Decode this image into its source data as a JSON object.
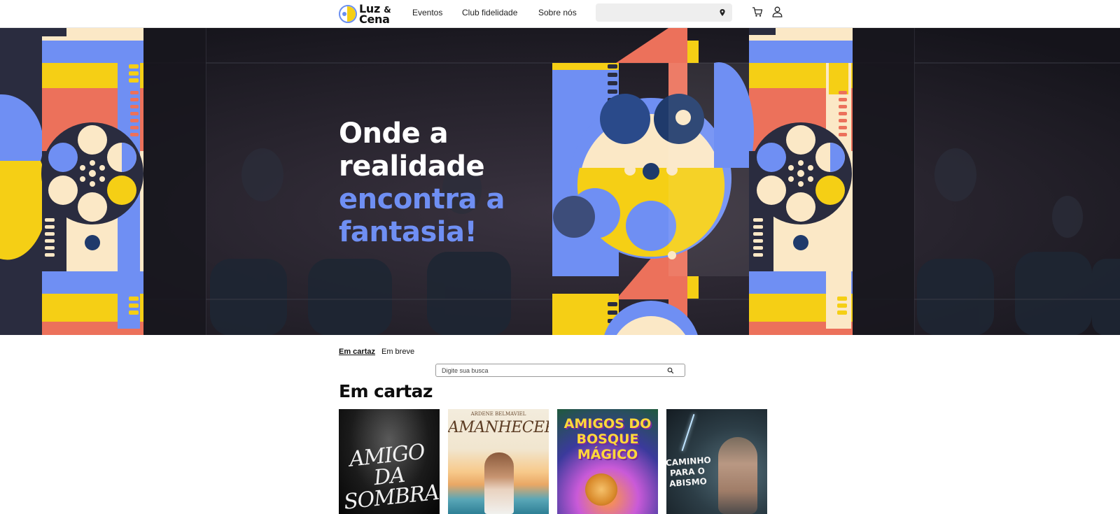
{
  "brand": {
    "line1": "Luz",
    "amp": "&",
    "line2": "Cena"
  },
  "nav": {
    "items": [
      "Eventos",
      "Club fidelidade",
      "Sobre nós"
    ]
  },
  "header_icons": {
    "location": "map-pin-icon",
    "cart": "cart-icon",
    "user": "user-icon"
  },
  "hero": {
    "line1": "Onde a",
    "line2": "realidade",
    "line3": "encontra a",
    "line4": "fantasia!",
    "accent_color": "#6f8ff3"
  },
  "tabs": {
    "active": "Em cartaz",
    "other": "Em breve"
  },
  "search": {
    "placeholder": "Digite sua busca"
  },
  "section": {
    "title": "Em cartaz"
  },
  "posters": [
    {
      "title": "AMIGO DA SOMBRA"
    },
    {
      "author": "ARDENE BELMAVIEL",
      "title": "AMANHECER"
    },
    {
      "title": "AMIGOS DO BOSQUE MÁGICO"
    },
    {
      "title": "CAMINHO PARA O ABISMO"
    }
  ],
  "colors": {
    "blue": "#6f8ff3",
    "yellow": "#f5cf15",
    "coral": "#ec715b",
    "cream": "#fbe8c6",
    "navy": "#2a2c3f"
  }
}
